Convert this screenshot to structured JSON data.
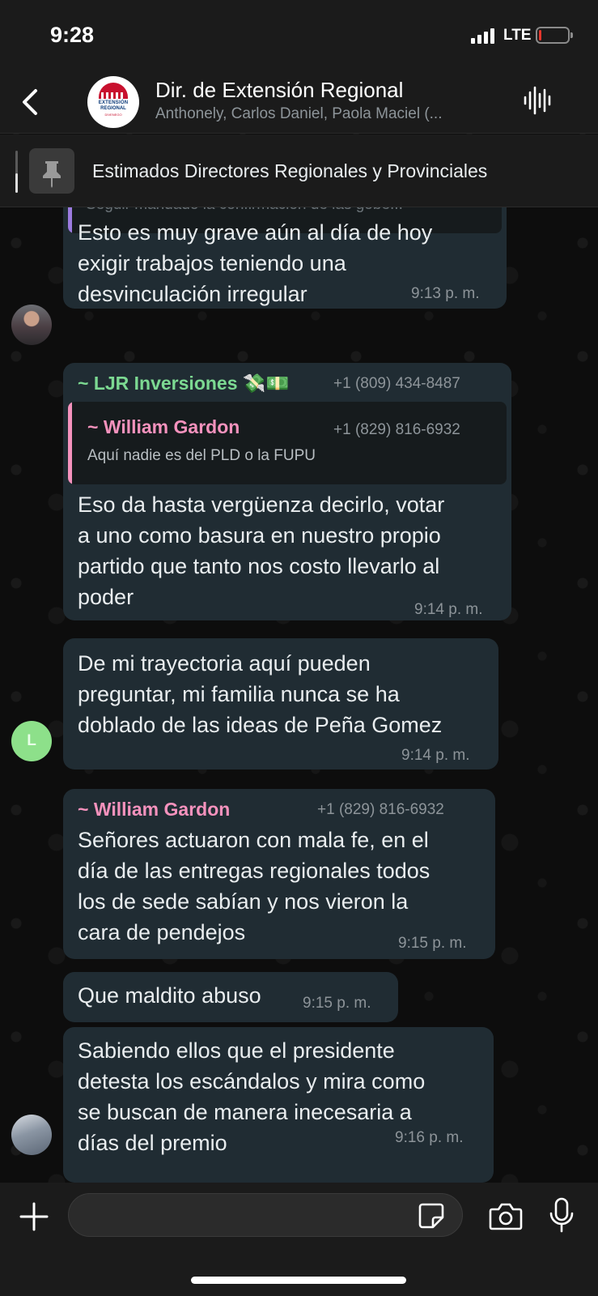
{
  "status_bar": {
    "time": "9:28",
    "network": "LTE",
    "battery_level": 0.08,
    "battery_color": "#e5362c"
  },
  "header": {
    "title": "Dir. de Extensión Regional",
    "members": "Anthonely, Carlos Daniel, Paola Maciel (...",
    "avatar_logo": {
      "line1": "EXTENSIÓN",
      "line2": "REGIONAL",
      "line3": "DIVENEGO"
    },
    "icons": {
      "back": "chevron-left-icon",
      "audio": "waveform-icon"
    }
  },
  "pinned": {
    "text": "Estimados Directores Regionales y Provinciales",
    "icon": "pin-icon"
  },
  "messages": [
    {
      "cut_reply_text": "Seguir mandado la confirmación de las gobe...",
      "text_lines": [
        "Esto es muy grave aún al día de hoy",
        "exigir trabajos teniendo una",
        "desvinculación irregular"
      ],
      "time": "9:13 p. m."
    },
    {
      "sender": "~ LJR Inversiones 💸💵",
      "phone": "+1 (809) 434-8487",
      "quote": {
        "author": "~ William Gardon",
        "phone": "+1 (829) 816-6932",
        "text": "Aquí nadie es del PLD o la FUPU"
      },
      "text_lines": [
        "Eso da hasta vergüenza decirlo, votar",
        "a uno como basura en nuestro propio",
        "partido que tanto nos costo llevarlo al",
        "poder"
      ],
      "time": "9:14 p. m."
    },
    {
      "text_lines": [
        "De mi trayectoria aquí pueden",
        "preguntar, mi familia nunca se ha",
        "doblado de las ideas de Peña Gomez"
      ],
      "time": "9:14 p. m.",
      "avatar_letter": "L"
    },
    {
      "sender": "~ William Gardon",
      "phone": "+1 (829) 816-6932",
      "text_lines": [
        "Señores actuaron con mala fe, en el",
        "día de las entregas regionales todos",
        "los de sede sabían y nos vieron la",
        "cara de pendejos"
      ],
      "time": "9:15 p. m."
    },
    {
      "text_lines": [
        "Que maldito abuso"
      ],
      "time": "9:15 p. m."
    },
    {
      "text_lines": [
        "Sabiendo ellos que el presidente",
        "detesta los escándalos y mira como",
        "se buscan de manera inecesaria a",
        "días del premio"
      ],
      "time": "9:16 p. m."
    }
  ],
  "colors": {
    "green_sender": "#7cd992",
    "pink_sender": "#f592bd"
  },
  "input": {
    "placeholder": ""
  }
}
